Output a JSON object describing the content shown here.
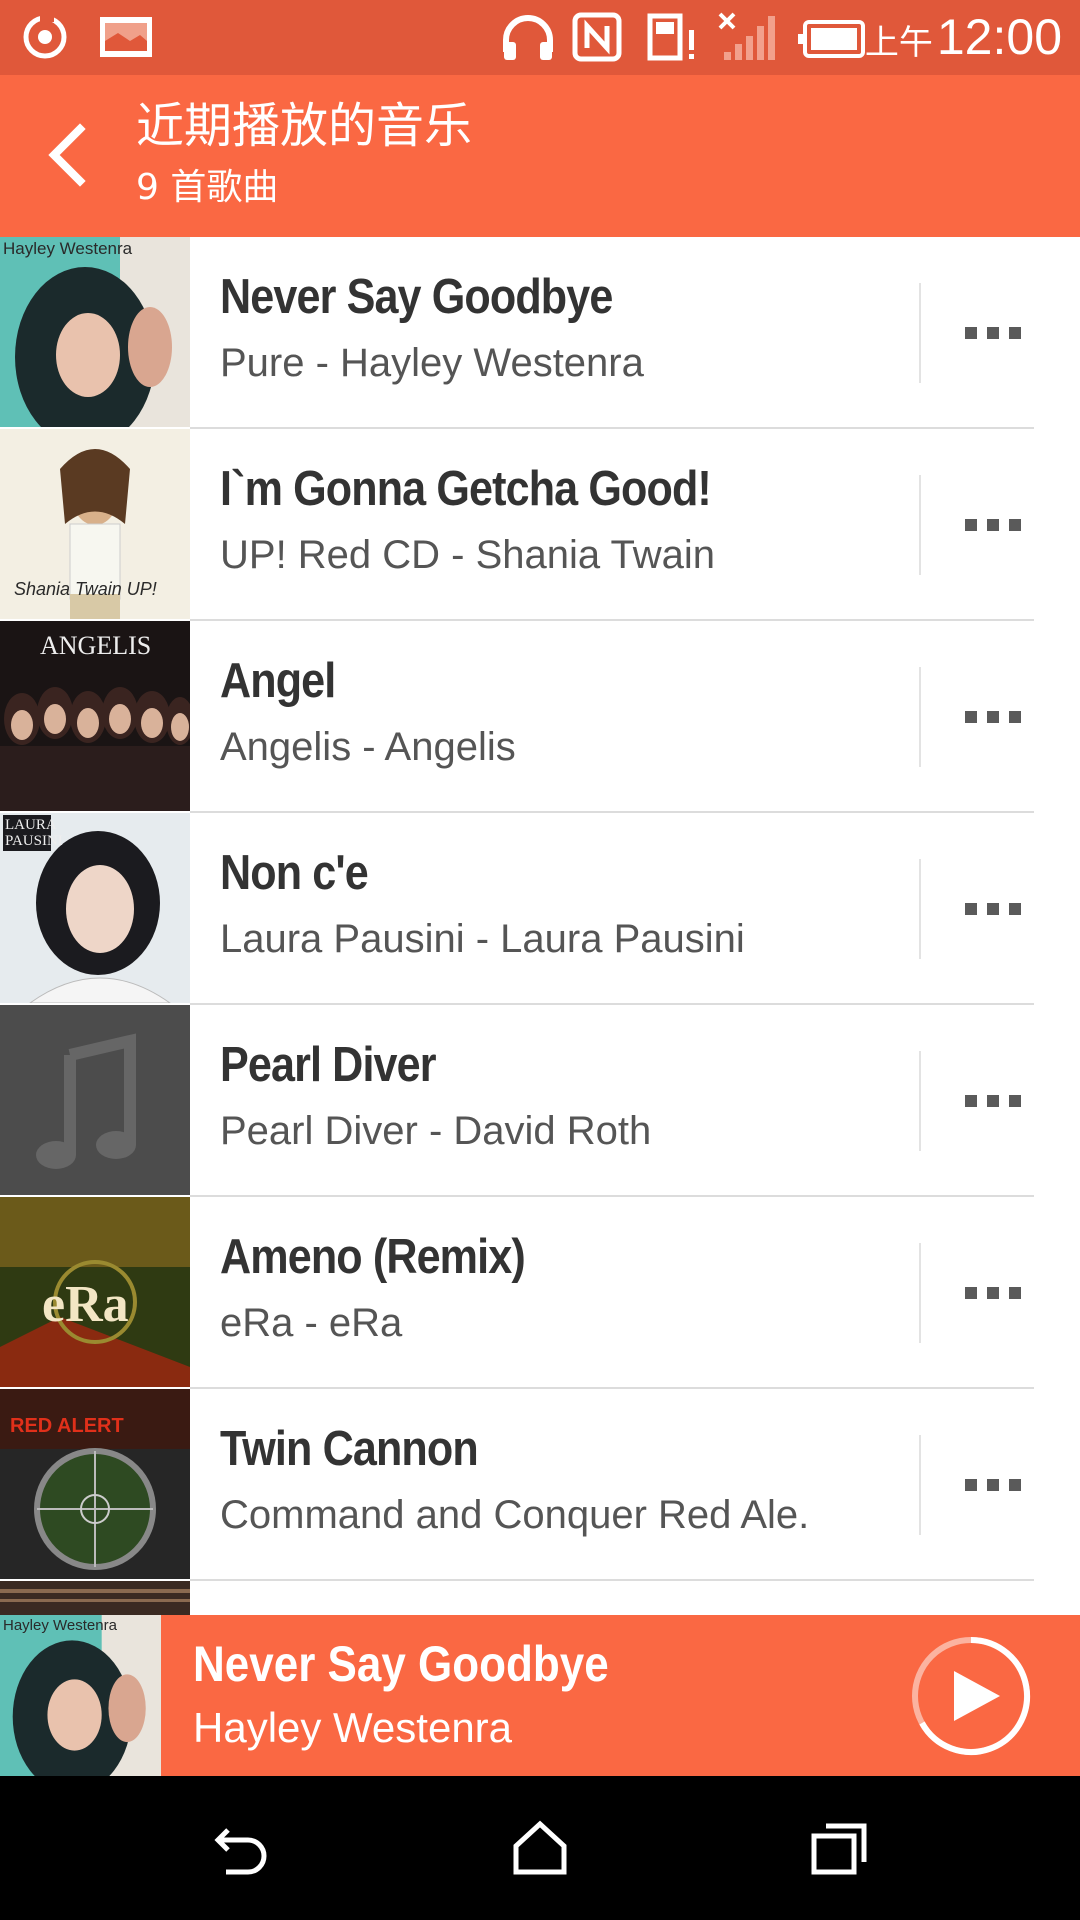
{
  "status_bar": {
    "ampm": "上午",
    "time": "12:00",
    "icons": [
      "refresh-circle-icon",
      "image-notification-icon",
      "headphones-icon",
      "nfc-icon",
      "sd-card-alert-icon",
      "signal-off-icon",
      "battery-icon"
    ]
  },
  "header": {
    "title": "近期播放的音乐",
    "subtitle": "9 首歌曲",
    "back_icon": "chevron-left-icon"
  },
  "songs": [
    {
      "title": "Never Say Goodbye",
      "subtitle": "Pure - Hayley Westenra",
      "art_label": "Hayley Westenra"
    },
    {
      "title": "I`m Gonna Getcha Good!",
      "subtitle": "UP! Red CD - Shania Twain",
      "art_label": "Shania Twain UP!"
    },
    {
      "title": "Angel",
      "subtitle": "Angelis - Angelis",
      "art_label": "ANGELIS"
    },
    {
      "title": "Non c'e",
      "subtitle": "Laura Pausini - Laura Pausini",
      "art_label": "LAURA PAUSINI"
    },
    {
      "title": "Pearl Diver",
      "subtitle": "Pearl Diver - David Roth",
      "art_label": ""
    },
    {
      "title": "Ameno (Remix)",
      "subtitle": "eRa - eRa",
      "art_label": "eRa"
    },
    {
      "title": "Twin Cannon",
      "subtitle": "Command and Conquer Red Ale.",
      "art_label": "RED ALERT"
    }
  ],
  "now_playing": {
    "title": "Never Say Goodbye",
    "artist": "Hayley Westenra",
    "art_label": "Hayley Westenra",
    "play_icon": "play-icon"
  },
  "nav_bar": {
    "icons": [
      "back-arrow-icon",
      "home-icon",
      "recent-apps-icon"
    ]
  },
  "colors": {
    "accent": "#fa6843",
    "status_bar": "#e0583a",
    "nav_bar": "#000000"
  }
}
